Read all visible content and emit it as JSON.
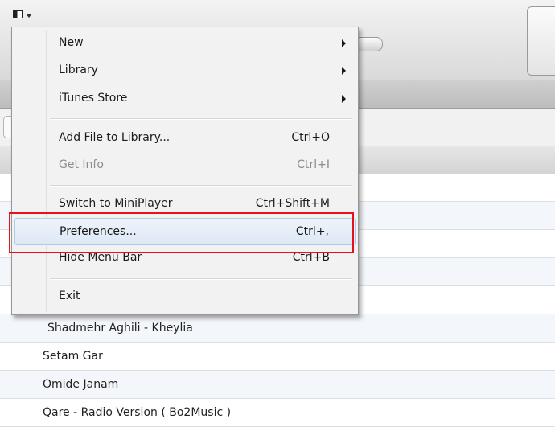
{
  "menu": {
    "items": [
      {
        "label": "New",
        "accel": "",
        "submenu": true
      },
      {
        "label": "Library",
        "accel": "",
        "submenu": true
      },
      {
        "label": "iTunes Store",
        "accel": "",
        "submenu": true
      },
      {
        "label": "Add File to Library...",
        "accel": "Ctrl+O"
      },
      {
        "label": "Get Info",
        "accel": "Ctrl+I",
        "disabled": true
      },
      {
        "label": "Switch to MiniPlayer",
        "accel": "Ctrl+Shift+M"
      },
      {
        "label": "Preferences...",
        "accel": "Ctrl+,",
        "highlighted": true
      },
      {
        "label": "Hide Menu Bar",
        "accel": "Ctrl+B"
      },
      {
        "label": "Exit",
        "accel": ""
      }
    ]
  },
  "songs": [
    {
      "title": "Shadmehr Aghili - Kheylia"
    },
    {
      "title": "Setam Gar"
    },
    {
      "title": "Omide Janam"
    },
    {
      "title": "Qare - Radio Version ( Bo2Music )"
    }
  ],
  "colors": {
    "highlight_box": "#e8101a",
    "menu_bg": "#f2f2f2"
  },
  "icons": {
    "app_menu": "window-menu-icon",
    "dropdown": "caret-down-icon"
  }
}
